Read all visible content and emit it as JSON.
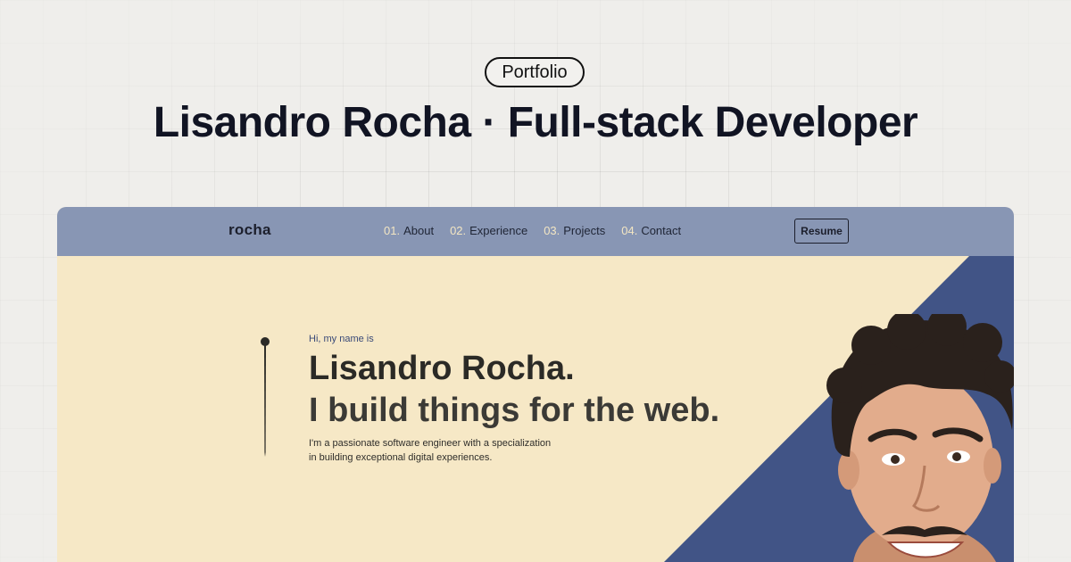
{
  "badge": {
    "label": "Portfolio"
  },
  "headline": {
    "text": "Lisandro Rocha · Full-stack Developer"
  },
  "site": {
    "logo": "rocha",
    "nav": [
      {
        "num": "01.",
        "label": "About"
      },
      {
        "num": "02.",
        "label": "Experience"
      },
      {
        "num": "03.",
        "label": "Projects"
      },
      {
        "num": "04.",
        "label": "Contact"
      }
    ],
    "resume_label": "Resume",
    "hero": {
      "greeting": "Hi, my name is",
      "name": "Lisandro Rocha.",
      "tagline": "I build things for the web.",
      "description_line1": "I'm a passionate software engineer with a specialization",
      "description_line2": "in building exceptional digital experiences."
    }
  },
  "colors": {
    "page_bg": "#efeeeb",
    "navbar": "#8896b4",
    "hero_bg": "#f6e8c6",
    "accent_blue": "#415486",
    "text_dark": "#2b2a26"
  },
  "icons": [
    "timeline-dot-icon",
    "portrait-photo"
  ]
}
